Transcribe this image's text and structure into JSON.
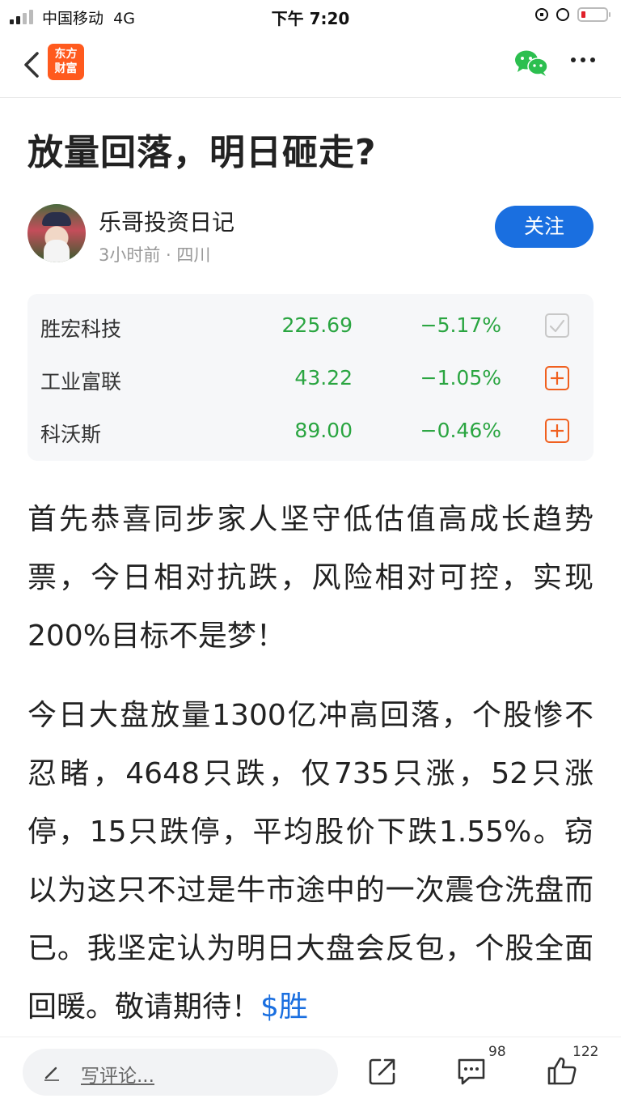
{
  "status_bar": {
    "carrier": "中国移动",
    "network": "4G",
    "time": "下午 7:20",
    "battery_level": 0.15
  },
  "nav": {
    "logo_text": [
      "东方",
      "财富"
    ],
    "logo_color": "#ff5a1e"
  },
  "article": {
    "title": "放量回落，明日砸走?",
    "author": "乐哥投资日记",
    "meta": "3小时前 · 四川",
    "follow_label": "关注"
  },
  "stocks": [
    {
      "name": "胜宏科技",
      "price": "225.69",
      "change": "−5.17%",
      "added": true
    },
    {
      "name": "工业富联",
      "price": "43.22",
      "change": "−1.05%",
      "added": false
    },
    {
      "name": "科沃斯",
      "price": "89.00",
      "change": "−0.46%",
      "added": false
    }
  ],
  "body": {
    "p1": "首先恭喜同步家人坚守低估值高成长趋势票，今日相对抗跌，风险相对可控，实现200%目标不是梦！",
    "p2": "今日大盘放量1300亿冲高回落，个股惨不忍睹，4648只跌，仅735只涨，52只涨停，15只跌停，平均股价下跌1.55%。窃以为这只不过是牛市途中的一次震仓洗盘而已。我坚定认为明日大盘会反包，个股全面回暖。敬请期待！",
    "cashtag": "$胜"
  },
  "bottom_bar": {
    "comment_placeholder": "写评论...",
    "comment_count": "98",
    "like_count": "122"
  },
  "colors": {
    "accent_blue": "#1a6fe0",
    "down_green": "#2aa541",
    "add_orange": "#f0601f"
  }
}
